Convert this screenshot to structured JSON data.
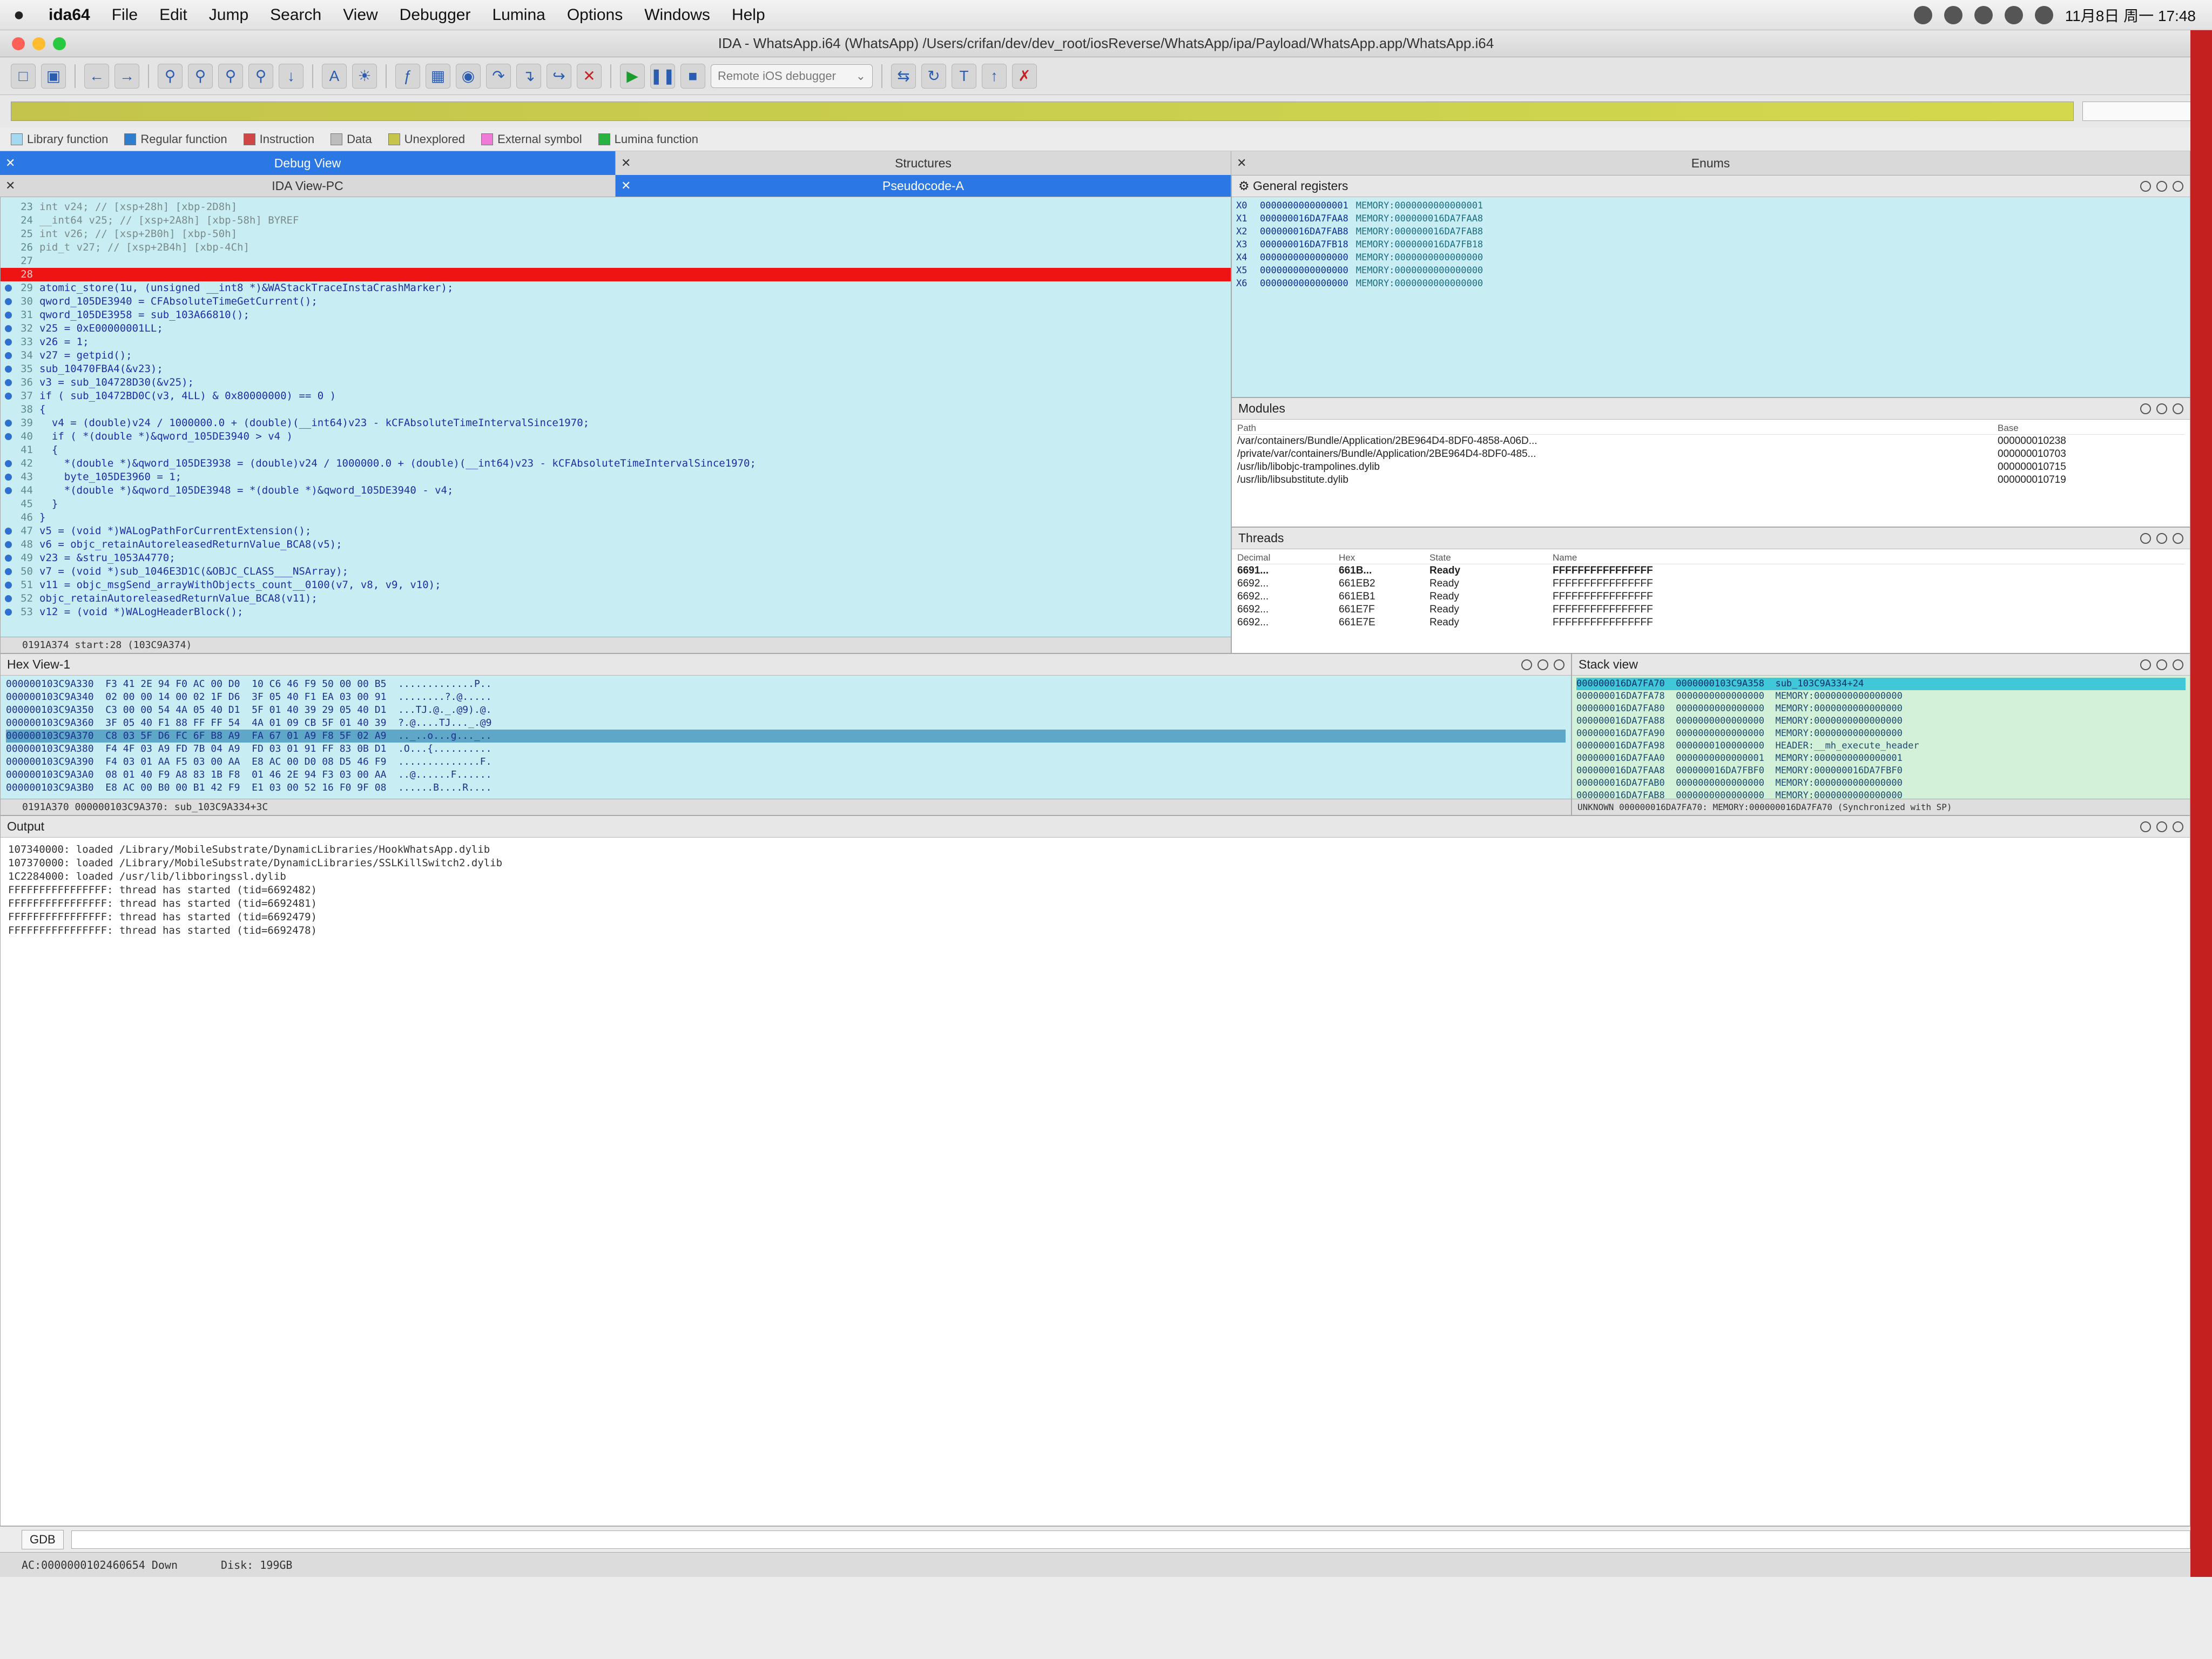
{
  "menubar": {
    "app": "ida64",
    "items": [
      "File",
      "Edit",
      "Jump",
      "Search",
      "View",
      "Debugger",
      "Lumina",
      "Options",
      "Windows",
      "Help"
    ],
    "clock": "11月8日 周一 17:48"
  },
  "window": {
    "title": "IDA - WhatsApp.i64 (WhatsApp) /Users/crifan/dev/dev_root/iosReverse/WhatsApp/ipa/Payload/WhatsApp.app/WhatsApp.i64"
  },
  "toolbar": {
    "debugger_select": "Remote iOS debugger"
  },
  "legend": [
    "Library function",
    "Regular function",
    "Instruction",
    "Data",
    "Unexplored",
    "External symbol",
    "Lumina function"
  ],
  "colors": {
    "library": "#a6d8f0",
    "regular": "#2f7dcd",
    "instruction": "#d04545",
    "data": "#bdbdbd",
    "unexplored": "#c6c44a",
    "external": "#f07ad8",
    "lumina": "#27b33f",
    "accent": "#2b78e4",
    "breakpoint": "#ee1414"
  },
  "tabs": {
    "debug_view": "Debug View",
    "structures": "Structures",
    "enums": "Enums",
    "ida_view": "IDA View-PC",
    "pseudocode": "Pseudocode-A"
  },
  "pseudocode": {
    "lines": [
      {
        "n": "23",
        "t": "int v24; // [xsp+28h] [xbp-2D8h]",
        "k": "cmt"
      },
      {
        "n": "24",
        "t": "__int64 v25; // [xsp+2A8h] [xbp-58h] BYREF",
        "k": "cmt"
      },
      {
        "n": "25",
        "t": "int v26; // [xsp+2B0h] [xbp-50h]",
        "k": "cmt"
      },
      {
        "n": "26",
        "t": "pid_t v27; // [xsp+2B4h] [xbp-4Ch]",
        "k": "cmt"
      },
      {
        "n": "27",
        "t": "",
        "k": ""
      },
      {
        "n": "28",
        "t": "",
        "k": "hl"
      },
      {
        "n": "29",
        "t": "atomic_store(1u, (unsigned __int8 *)&WAStackTraceInstaCrashMarker);",
        "k": "dot"
      },
      {
        "n": "30",
        "t": "qword_105DE3940 = CFAbsoluteTimeGetCurrent();",
        "k": "dot"
      },
      {
        "n": "31",
        "t": "qword_105DE3958 = sub_103A66810();",
        "k": "dot"
      },
      {
        "n": "32",
        "t": "v25 = 0xE00000001LL;",
        "k": "dot"
      },
      {
        "n": "33",
        "t": "v26 = 1;",
        "k": "dot"
      },
      {
        "n": "34",
        "t": "v27 = getpid();",
        "k": "dot"
      },
      {
        "n": "35",
        "t": "sub_10470FBA4(&v23);",
        "k": "dot"
      },
      {
        "n": "36",
        "t": "v3 = sub_104728D30(&v25);",
        "k": "dot"
      },
      {
        "n": "37",
        "t": "if ( sub_10472BD0C(v3, 4LL) & 0x80000000) == 0 )",
        "k": "dot"
      },
      {
        "n": "38",
        "t": "{",
        "k": ""
      },
      {
        "n": "39",
        "t": "  v4 = (double)v24 / 1000000.0 + (double)(__int64)v23 - kCFAbsoluteTimeIntervalSince1970;",
        "k": "dot"
      },
      {
        "n": "40",
        "t": "  if ( *(double *)&qword_105DE3940 > v4 )",
        "k": "dot"
      },
      {
        "n": "41",
        "t": "  {",
        "k": ""
      },
      {
        "n": "42",
        "t": "    *(double *)&qword_105DE3938 = (double)v24 / 1000000.0 + (double)(__int64)v23 - kCFAbsoluteTimeIntervalSince1970;",
        "k": "dot"
      },
      {
        "n": "43",
        "t": "    byte_105DE3960 = 1;",
        "k": "dot"
      },
      {
        "n": "44",
        "t": "    *(double *)&qword_105DE3948 = *(double *)&qword_105DE3940 - v4;",
        "k": "dot"
      },
      {
        "n": "45",
        "t": "  }",
        "k": ""
      },
      {
        "n": "46",
        "t": "}",
        "k": ""
      },
      {
        "n": "47",
        "t": "v5 = (void *)WALogPathForCurrentExtension();",
        "k": "dot"
      },
      {
        "n": "48",
        "t": "v6 = objc_retainAutoreleasedReturnValue_BCA8(v5);",
        "k": "dot"
      },
      {
        "n": "49",
        "t": "v23 = &stru_1053A4770;",
        "k": "dot"
      },
      {
        "n": "50",
        "t": "v7 = (void *)sub_1046E3D1C(&OBJC_CLASS___NSArray);",
        "k": "dot"
      },
      {
        "n": "51",
        "t": "v11 = objc_msgSend_arrayWithObjects_count__0100(v7, v8, v9, v10);",
        "k": "dot"
      },
      {
        "n": "52",
        "t": "objc_retainAutoreleasedReturnValue_BCA8(v11);",
        "k": "dot"
      },
      {
        "n": "53",
        "t": "v12 = (void *)WALogHeaderBlock();",
        "k": "dot"
      }
    ],
    "status": "0191A374 start:28 (103C9A374)"
  },
  "registers": {
    "title": "General registers",
    "rows": [
      {
        "r": "X0",
        "v": "0000000000000001",
        "m": "MEMORY:0000000000000001"
      },
      {
        "r": "X1",
        "v": "000000016DA7FAA8",
        "m": "MEMORY:000000016DA7FAA8"
      },
      {
        "r": "X2",
        "v": "000000016DA7FAB8",
        "m": "MEMORY:000000016DA7FAB8"
      },
      {
        "r": "X3",
        "v": "000000016DA7FB18",
        "m": "MEMORY:000000016DA7FB18"
      },
      {
        "r": "X4",
        "v": "0000000000000000",
        "m": "MEMORY:0000000000000000"
      },
      {
        "r": "X5",
        "v": "0000000000000000",
        "m": "MEMORY:0000000000000000"
      },
      {
        "r": "X6",
        "v": "0000000000000000",
        "m": "MEMORY:0000000000000000"
      }
    ]
  },
  "modules": {
    "title": "Modules",
    "col_path": "Path",
    "col_base": "Base",
    "rows": [
      {
        "p": "/var/containers/Bundle/Application/2BE964D4-8DF0-4858-A06D...",
        "b": "000000010238"
      },
      {
        "p": "/private/var/containers/Bundle/Application/2BE964D4-8DF0-485...",
        "b": "000000010703"
      },
      {
        "p": "/usr/lib/libobjc-trampolines.dylib",
        "b": "000000010715"
      },
      {
        "p": "/usr/lib/libsubstitute.dylib",
        "b": "000000010719"
      }
    ]
  },
  "threads": {
    "title": "Threads",
    "cols": [
      "Decimal",
      "Hex",
      "State",
      "Name"
    ],
    "rows": [
      {
        "d": "6691...",
        "h": "661B...",
        "s": "Ready",
        "n": "FFFFFFFFFFFFFFFF"
      },
      {
        "d": "6692...",
        "h": "661EB2",
        "s": "Ready",
        "n": "FFFFFFFFFFFFFFFF"
      },
      {
        "d": "6692...",
        "h": "661EB1",
        "s": "Ready",
        "n": "FFFFFFFFFFFFFFFF"
      },
      {
        "d": "6692...",
        "h": "661E7F",
        "s": "Ready",
        "n": "FFFFFFFFFFFFFFFF"
      },
      {
        "d": "6692...",
        "h": "661E7E",
        "s": "Ready",
        "n": "FFFFFFFFFFFFFFFF"
      }
    ]
  },
  "hexview": {
    "title": "Hex View-1",
    "rows": [
      "000000103C9A330  F3 41 2E 94 F0 AC 00 D0  10 C6 46 F9 50 00 00 B5  .............P..",
      "000000103C9A340  02 00 00 14 00 02 1F D6  3F 05 40 F1 EA 03 00 91  ........?.@.....",
      "000000103C9A350  C3 00 00 54 4A 05 40 D1  5F 01 40 39 29 05 40 D1  ...TJ.@._.@9).@.",
      "000000103C9A360  3F 05 40 F1 88 FF FF 54  4A 01 09 CB 5F 01 40 39  ?.@....TJ..._.@9",
      "000000103C9A370  C8 03 5F D6 FC 6F B8 A9  FA 67 01 A9 F8 5F 02 A9  .._..o...g..._..",
      "000000103C9A380  F4 4F 03 A9 FD 7B 04 A9  FD 03 01 91 FF 83 0B D1  .O...{..........",
      "000000103C9A390  F4 03 01 AA F5 03 00 AA  E8 AC 00 D0 08 D5 46 F9  ..............F.",
      "000000103C9A3A0  08 01 40 F9 A8 83 1B F8  01 46 2E 94 F3 03 00 AA  ..@......F......",
      "000000103C9A3B0  E8 AC 00 B0 00 B1 42 F9  E1 03 00 52 16 F0 9F 08  ......B....R...."
    ],
    "selected": 4,
    "status": "0191A370 000000103C9A370: sub_103C9A334+3C"
  },
  "stackview": {
    "title": "Stack view",
    "rows": [
      "000000016DA7FA70  0000000103C9A358  sub_103C9A334+24",
      "000000016DA7FA78  0000000000000000  MEMORY:0000000000000000",
      "000000016DA7FA80  0000000000000000  MEMORY:0000000000000000",
      "000000016DA7FA88  0000000000000000  MEMORY:0000000000000000",
      "000000016DA7FA90  0000000000000000  MEMORY:0000000000000000",
      "000000016DA7FA98  0000000100000000  HEADER:__mh_execute_header",
      "000000016DA7FAA0  0000000000000001  MEMORY:0000000000000001",
      "000000016DA7FAA8  000000016DA7FBF0  MEMORY:000000016DA7FBF0",
      "000000016DA7FAB0  0000000000000000  MEMORY:0000000000000000",
      "000000016DA7FAB8  0000000000000000  MEMORY:0000000000000000"
    ],
    "status": "UNKNOWN 000000016DA7FA70: MEMORY:000000016DA7FA70 (Synchronized with SP)"
  },
  "output": {
    "title": "Output",
    "lines": [
      "107340000: loaded /Library/MobileSubstrate/DynamicLibraries/HookWhatsApp.dylib",
      "107370000: loaded /Library/MobileSubstrate/DynamicLibraries/SSLKillSwitch2.dylib",
      "1C2284000: loaded /usr/lib/libboringssl.dylib",
      "FFFFFFFFFFFFFFFF: thread has started (tid=6692482)",
      "FFFFFFFFFFFFFFFF: thread has started (tid=6692481)",
      "FFFFFFFFFFFFFFFF: thread has started (tid=6692479)",
      "FFFFFFFFFFFFFFFF: thread has started (tid=6692478)"
    ]
  },
  "command": {
    "lang": "GDB"
  },
  "statusbar": {
    "left": "AC:0000000102460654 Down",
    "disk": "Disk: 199GB"
  }
}
